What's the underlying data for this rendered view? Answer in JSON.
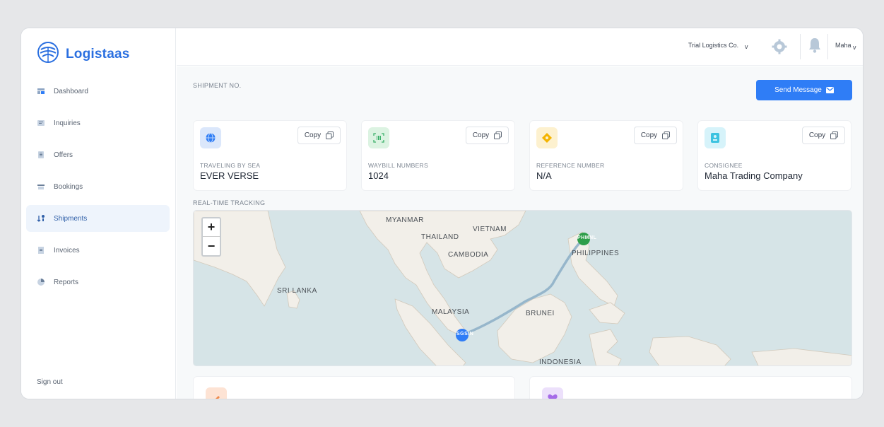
{
  "brand": {
    "name": "Logistaas",
    "color": "#2a6fe0"
  },
  "sidebar": {
    "items": [
      {
        "label": "Dashboard",
        "icon": "dashboard-icon",
        "active": false
      },
      {
        "label": "Inquiries",
        "icon": "inquiries-icon",
        "active": false
      },
      {
        "label": "Offers",
        "icon": "offers-icon",
        "active": false
      },
      {
        "label": "Bookings",
        "icon": "bookings-icon",
        "active": false
      },
      {
        "label": "Shipments",
        "icon": "shipments-icon",
        "active": true
      },
      {
        "label": "Invoices",
        "icon": "invoices-icon",
        "active": false
      },
      {
        "label": "Reports",
        "icon": "reports-icon",
        "active": false
      }
    ],
    "signout": "Sign out"
  },
  "header": {
    "company": "Trial Logistics Co.",
    "company_chevron": "v",
    "user": "Maha",
    "user_chevron": "v"
  },
  "main": {
    "shipment_label": "SHIPMENT NO.",
    "send_message": "Send Message",
    "cards": [
      {
        "label": "TRAVELING BY SEA",
        "value": "EVER VERSE",
        "copy": "Copy",
        "icon": "globe-icon",
        "color": "#dbe7fb"
      },
      {
        "label": "WAYBILL NUMBERS",
        "value": "1024",
        "copy": "Copy",
        "icon": "barcode-icon",
        "color": "#dcf3e2"
      },
      {
        "label": "REFERENCE NUMBER",
        "value": "N/A",
        "copy": "Copy",
        "icon": "reference-icon",
        "color": "#fdf1cf"
      },
      {
        "label": "CONSIGNEE",
        "value": "Maha Trading Company",
        "copy": "Copy",
        "icon": "consignee-icon",
        "color": "#d6f3fa"
      }
    ],
    "tracking_label": "REAL-TIME TRACKING"
  },
  "map": {
    "zoom_in": "+",
    "zoom_out": "−",
    "labels": [
      "MYANMAR",
      "THAILAND",
      "VIETNAM",
      "CAMBODIA",
      "PHILIPPINES",
      "SRI LANKA",
      "MALAYSIA",
      "BRUNEI",
      "INDONESIA"
    ],
    "origin_code": "SGSIN",
    "destination_code": "PHMNL",
    "origin_color": "#2f7df6",
    "destination_color": "#2e9e4a",
    "route_color": "#8fb0c8"
  }
}
